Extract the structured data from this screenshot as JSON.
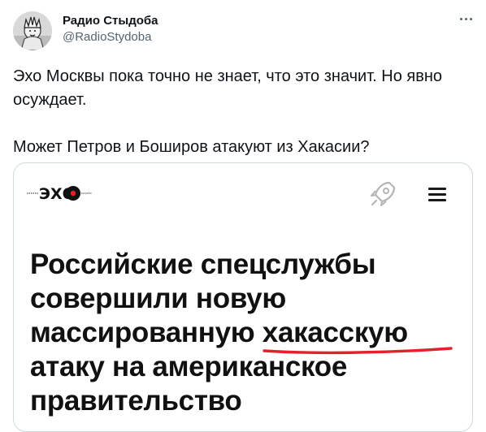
{
  "author": {
    "name": "Радио Стыдоба",
    "handle": "@RadioStydoba",
    "avatar_icon": "statue-of-liberty-avatar"
  },
  "tweet": {
    "paragraphs": [
      "Эхо Москвы пока точно не знает, что это значит. Но явно осуждает.",
      "Может Петров и Боширов атакуют из Хакасии?"
    ]
  },
  "media": {
    "logo_text": "ЭХО",
    "headline_before": "Российские спецслужбы совершили новую массированную",
    "headline_highlight": "хакасскую",
    "headline_after": "атаку на американское правительство",
    "underline_color": "#e3202c",
    "icons": [
      "echo-logo-icon",
      "rocket-icon",
      "hamburger-menu-icon"
    ]
  },
  "colors": {
    "text_primary": "#0f1419",
    "text_secondary": "#536471",
    "border": "#cfd9de"
  }
}
